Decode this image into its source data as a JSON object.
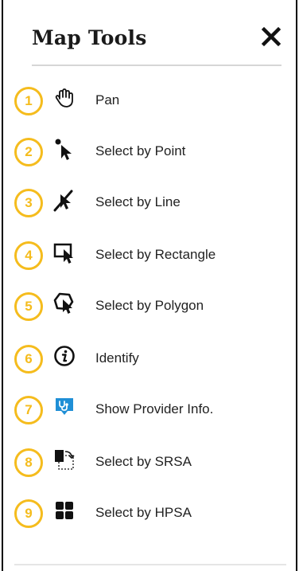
{
  "panel": {
    "title": "Map Tools",
    "close_icon": "close-icon"
  },
  "tools": [
    {
      "number": "1",
      "label": "Pan",
      "icon": "pan-hand-icon"
    },
    {
      "number": "2",
      "label": "Select by Point",
      "icon": "select-point-icon"
    },
    {
      "number": "3",
      "label": "Select by Line",
      "icon": "select-line-icon"
    },
    {
      "number": "4",
      "label": "Select by Rectangle",
      "icon": "select-rectangle-icon"
    },
    {
      "number": "5",
      "label": "Select by Polygon",
      "icon": "select-polygon-icon"
    },
    {
      "number": "6",
      "label": "Identify",
      "icon": "identify-icon"
    },
    {
      "number": "7",
      "label": "Show Provider Info.",
      "icon": "provider-info-icon"
    },
    {
      "number": "8",
      "label": "Select by SRSA",
      "icon": "select-srsa-icon"
    },
    {
      "number": "9",
      "label": "Select by HPSA",
      "icon": "select-hpsa-icon"
    }
  ],
  "colors": {
    "badge": "#f5bc1d",
    "provider_icon": "#1f8fd6",
    "text": "#222222"
  }
}
